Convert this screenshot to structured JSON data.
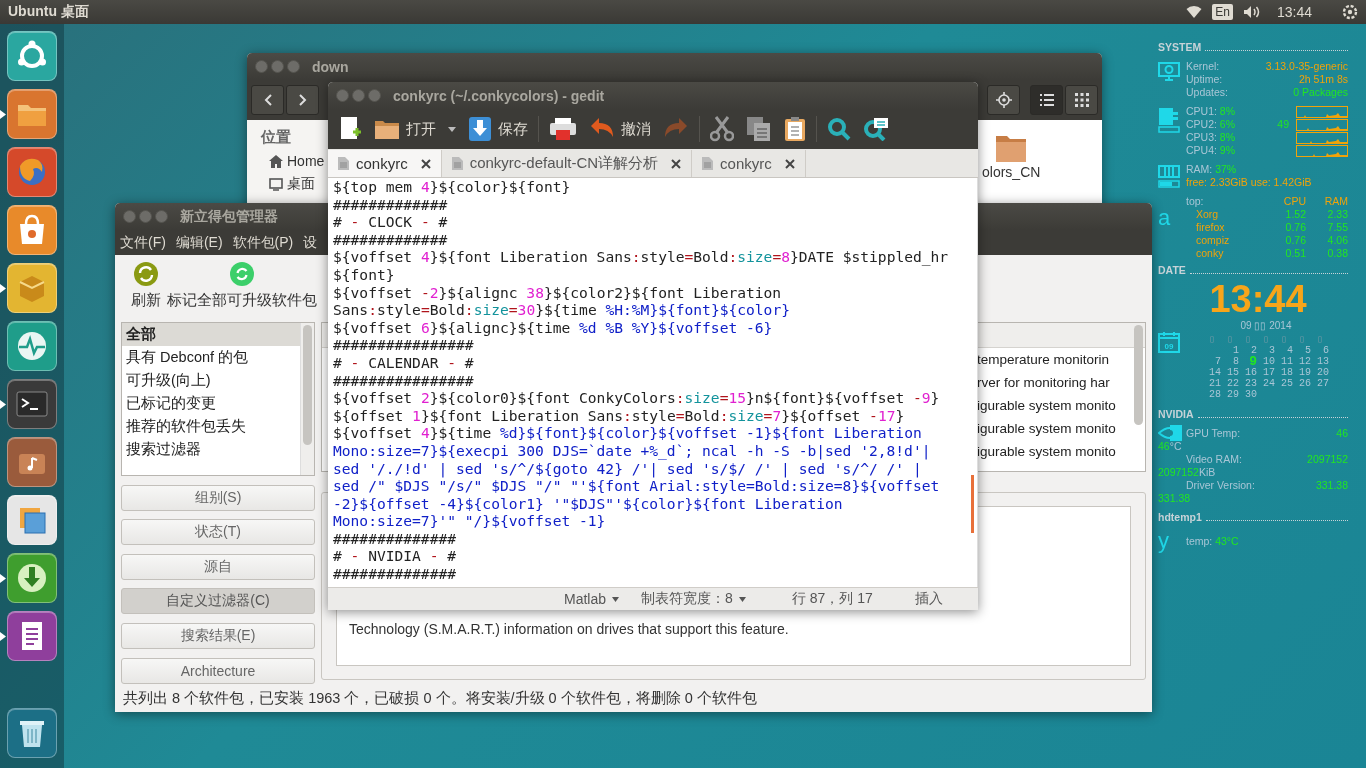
{
  "top_panel": {
    "title": "Ubuntu 桌面",
    "keyboard": "En",
    "clock": "13:44"
  },
  "launcher": {
    "items": [
      {
        "kind": "dash",
        "running": false
      },
      {
        "kind": "files",
        "running": true
      },
      {
        "kind": "browser",
        "running": false
      },
      {
        "kind": "store",
        "running": false
      },
      {
        "kind": "package",
        "running": true
      },
      {
        "kind": "monitor",
        "running": false
      },
      {
        "kind": "terminal",
        "running": true
      },
      {
        "kind": "media",
        "running": false
      },
      {
        "kind": "window",
        "running": false
      },
      {
        "kind": "download",
        "running": true
      },
      {
        "kind": "document",
        "running": true
      },
      {
        "kind": "trash",
        "running": false
      }
    ]
  },
  "file_manager": {
    "title": "down",
    "sidebar_heading": "位置",
    "places": [
      "Home",
      "桌面"
    ],
    "folder_label": "olors_CN"
  },
  "synaptic": {
    "title": "新立得包管理器",
    "menu": [
      "文件(F)",
      "编辑(E)",
      "软件包(P)",
      "设"
    ],
    "toolbar": [
      {
        "kind": "refresh",
        "label": "刷新"
      },
      {
        "kind": "mark",
        "label": "标记全部可升级软件包"
      }
    ],
    "filters": [
      {
        "label": "全部",
        "selected": true
      },
      {
        "label": "具有 Debconf 的包",
        "selected": false
      },
      {
        "label": "可升级(向上)",
        "selected": false
      },
      {
        "label": "已标记的变更",
        "selected": false
      },
      {
        "label": "推荐的软件包丢失",
        "selected": false
      },
      {
        "label": "搜索过滤器",
        "selected": false
      }
    ],
    "view_buttons": [
      {
        "label": "组别(S)",
        "selected": false
      },
      {
        "label": "状态(T)",
        "selected": false
      },
      {
        "label": "源自",
        "selected": false
      },
      {
        "label": "自定义过滤器(C)",
        "selected": true
      },
      {
        "label": "搜索结果(E)",
        "selected": false
      },
      {
        "label": "Architecture",
        "selected": false
      }
    ],
    "package_descriptions": [
      "temperature monitorin",
      "rver for monitoring har",
      "igurable system monito",
      "igurable system monito",
      "igurable system monito"
    ],
    "description": "Technology (S.M.A.R.T.) information on drives that support this feature.",
    "status_bar": "共列出 8 个软件包，已安装 1963 个，已破损 0 个。将安装/升级 0 个软件包，将删除 0 个软件包"
  },
  "gedit": {
    "title": "conkyrc (~/.conkycolors) - gedit",
    "toolbar": [
      {
        "kind": "new"
      },
      {
        "kind": "open",
        "label": "打开"
      },
      {
        "kind": "dropdown"
      },
      {
        "kind": "save",
        "label": "保存"
      },
      {
        "kind": "print"
      },
      {
        "kind": "undo",
        "label": "撤消"
      },
      {
        "kind": "redo"
      },
      {
        "kind": "cut"
      },
      {
        "kind": "copy"
      },
      {
        "kind": "paste"
      },
      {
        "kind": "search"
      },
      {
        "kind": "replace"
      }
    ],
    "tabs": [
      {
        "label": "conkyrc",
        "selected": true
      },
      {
        "label": "conkyrc-default-CN详解分析",
        "selected": false
      },
      {
        "label": "conkyrc",
        "selected": false
      }
    ],
    "code": [
      [
        {
          "kind": "plain",
          "text": "${top mem "
        },
        {
          "kind": "number",
          "text": "4"
        },
        {
          "kind": "plain",
          "text": "}${color}${font}"
        }
      ],
      [
        {
          "kind": "plain",
          "text": "#############"
        }
      ],
      [
        {
          "kind": "plain",
          "text": "# "
        },
        {
          "kind": "symbol",
          "text": "-"
        },
        {
          "kind": "plain",
          "text": " CLOCK "
        },
        {
          "kind": "symbol",
          "text": "-"
        },
        {
          "kind": "plain",
          "text": " #"
        }
      ],
      [
        {
          "kind": "plain",
          "text": "#############"
        }
      ],
      [
        {
          "kind": "plain",
          "text": "${voffset "
        },
        {
          "kind": "number",
          "text": "4"
        },
        {
          "kind": "plain",
          "text": "}${font Liberation Sans"
        },
        {
          "kind": "symbol",
          "text": ":"
        },
        {
          "kind": "plain",
          "text": "style"
        },
        {
          "kind": "symbol",
          "text": "="
        },
        {
          "kind": "plain",
          "text": "Bold"
        },
        {
          "kind": "symbol",
          "text": ":"
        },
        {
          "kind": "key",
          "text": "size"
        },
        {
          "kind": "symbol",
          "text": "="
        },
        {
          "kind": "number",
          "text": "8"
        },
        {
          "kind": "plain",
          "text": "}DATE $stippled_hr"
        }
      ],
      [
        {
          "kind": "plain",
          "text": "${font}"
        }
      ],
      [
        {
          "kind": "plain",
          "text": "${voffset "
        },
        {
          "kind": "symbol",
          "text": "-"
        },
        {
          "kind": "number",
          "text": "2"
        },
        {
          "kind": "plain",
          "text": "}${alignc "
        },
        {
          "kind": "number",
          "text": "38"
        },
        {
          "kind": "plain",
          "text": "}${color2}${font Liberation"
        }
      ],
      [
        {
          "kind": "plain",
          "text": "Sans"
        },
        {
          "kind": "symbol",
          "text": ":"
        },
        {
          "kind": "plain",
          "text": "style"
        },
        {
          "kind": "symbol",
          "text": "="
        },
        {
          "kind": "plain",
          "text": "Bold"
        },
        {
          "kind": "symbol",
          "text": ":"
        },
        {
          "kind": "key",
          "text": "size"
        },
        {
          "kind": "symbol",
          "text": "="
        },
        {
          "kind": "number",
          "text": "30"
        },
        {
          "kind": "plain",
          "text": "}${time "
        },
        {
          "kind": "string",
          "text": "%H:%M}${font}${color}"
        }
      ],
      [
        {
          "kind": "plain",
          "text": "${voffset "
        },
        {
          "kind": "number",
          "text": "6"
        },
        {
          "kind": "plain",
          "text": "}${alignc}${time "
        },
        {
          "kind": "string",
          "text": "%d %B %Y}${voffset -6}"
        }
      ],
      [
        {
          "kind": "plain",
          "text": "################"
        }
      ],
      [
        {
          "kind": "plain",
          "text": "# "
        },
        {
          "kind": "symbol",
          "text": "-"
        },
        {
          "kind": "plain",
          "text": " CALENDAR "
        },
        {
          "kind": "symbol",
          "text": "-"
        },
        {
          "kind": "plain",
          "text": " #"
        }
      ],
      [
        {
          "kind": "plain",
          "text": "################"
        }
      ],
      [
        {
          "kind": "plain",
          "text": "${voffset "
        },
        {
          "kind": "number",
          "text": "2"
        },
        {
          "kind": "plain",
          "text": "}${color0}${font ConkyColors"
        },
        {
          "kind": "symbol",
          "text": ":"
        },
        {
          "kind": "key",
          "text": "size"
        },
        {
          "kind": "symbol",
          "text": "="
        },
        {
          "kind": "number",
          "text": "15"
        },
        {
          "kind": "plain",
          "text": "}n${font}${voffset "
        },
        {
          "kind": "symbol",
          "text": "-"
        },
        {
          "kind": "number",
          "text": "9"
        },
        {
          "kind": "plain",
          "text": "}"
        }
      ],
      [
        {
          "kind": "plain",
          "text": "${offset "
        },
        {
          "kind": "number",
          "text": "1"
        },
        {
          "kind": "plain",
          "text": "}${font Liberation Sans"
        },
        {
          "kind": "symbol",
          "text": ":"
        },
        {
          "kind": "plain",
          "text": "style"
        },
        {
          "kind": "symbol",
          "text": "="
        },
        {
          "kind": "plain",
          "text": "Bold"
        },
        {
          "kind": "symbol",
          "text": ":"
        },
        {
          "kind": "key",
          "text": "size"
        },
        {
          "kind": "symbol",
          "text": "="
        },
        {
          "kind": "number",
          "text": "7"
        },
        {
          "kind": "plain",
          "text": "}${offset "
        },
        {
          "kind": "symbol",
          "text": "-"
        },
        {
          "kind": "number",
          "text": "17"
        },
        {
          "kind": "plain",
          "text": "}"
        }
      ],
      [
        {
          "kind": "plain",
          "text": "${voffset "
        },
        {
          "kind": "number",
          "text": "4"
        },
        {
          "kind": "plain",
          "text": "}${time "
        },
        {
          "kind": "string",
          "text": "%d}${font}${color}${voffset -1}${font Liberation"
        }
      ],
      [
        {
          "kind": "string",
          "text": "Mono:size=7}${execpi 300 DJS=`date +%_d`; ncal -h -S -b|sed '2,8!d'|"
        }
      ],
      [
        {
          "kind": "string",
          "text": "sed '/./!d' | sed 's/^/${goto 42} /'| sed 's/$/ /' | sed 's/^/ /' |"
        }
      ],
      [
        {
          "kind": "string",
          "text": "sed /\" $DJS \"/s/\" $DJS \"/\" \"'${font Arial:style=Bold:size=8}${voffset"
        }
      ],
      [
        {
          "kind": "string",
          "text": "-2}${offset -4}${color1} '\"$DJS\"'${color}${font Liberation"
        }
      ],
      [
        {
          "kind": "string",
          "text": "Mono:size=7}'\" \"/}${voffset -1}"
        }
      ],
      [
        {
          "kind": "plain",
          "text": "##############"
        }
      ],
      [
        {
          "kind": "plain",
          "text": "# "
        },
        {
          "kind": "symbol",
          "text": "-"
        },
        {
          "kind": "plain",
          "text": " NVIDIA "
        },
        {
          "kind": "symbol",
          "text": "-"
        },
        {
          "kind": "plain",
          "text": " #"
        }
      ],
      [
        {
          "kind": "plain",
          "text": "##############"
        }
      ]
    ],
    "status": {
      "language": "Matlab",
      "tab_width": "制表符宽度：8",
      "position": "行 87，列 17",
      "mode": "插入"
    }
  },
  "conky": {
    "system": {
      "heading": "SYSTEM",
      "info": [
        {
          "label": "Kernel:",
          "value": "3.13.0-35-generic",
          "color": "#f0a30a"
        },
        {
          "label": "Uptime:",
          "value": "2h 51m 8s",
          "color": "#f0a30a"
        },
        {
          "label": "Updates:",
          "value": "0 Packages",
          "color": "#22e622"
        }
      ],
      "cpus": [
        {
          "label": "CPU1:",
          "value": "8%"
        },
        {
          "label": "CPU2:",
          "value": "6%",
          "extra": "49"
        },
        {
          "label": "CPU3:",
          "value": "8%"
        },
        {
          "label": "CPU4:",
          "value": "9%"
        }
      ],
      "ram": {
        "label": "RAM:",
        "value": "37%",
        "free_label": "free:",
        "free": "2.33GiB",
        "use_label": "use:",
        "use": "1.42GiB"
      },
      "top": {
        "glyph": "a",
        "label": "top:",
        "cpu_heading": "CPU",
        "ram_heading": "RAM",
        "processes": [
          {
            "name": "Xorg",
            "cpu": "1.52",
            "ram": "2.33"
          },
          {
            "name": "firefox",
            "cpu": "0.76",
            "ram": "7.55"
          },
          {
            "name": "compiz",
            "cpu": "0.76",
            "ram": "4.06"
          },
          {
            "name": "conky",
            "cpu": "0.51",
            "ram": "0.38"
          }
        ]
      }
    },
    "date": {
      "heading": "DATE",
      "time": "13:44",
      "icon_day": "09",
      "month_line": "09 ▯▯ 2014",
      "weekdays": [
        "▯",
        "▯",
        "▯",
        "▯",
        "▯",
        "▯",
        "▯"
      ],
      "weeks": [
        [
          {
            "day": "1",
            "selected": false
          },
          {
            "day": "2",
            "selected": false
          },
          {
            "day": "3",
            "selected": false
          },
          {
            "day": "4",
            "selected": false
          },
          {
            "day": "5",
            "selected": false
          },
          {
            "day": "6",
            "selected": false
          }
        ],
        [
          {
            "day": "7",
            "selected": false
          },
          {
            "day": "8",
            "selected": false
          },
          {
            "day": "9",
            "selected": true
          },
          {
            "day": "10",
            "selected": false
          },
          {
            "day": "11",
            "selected": false
          },
          {
            "day": "12",
            "selected": false
          },
          {
            "day": "13",
            "selected": false
          }
        ],
        [
          {
            "day": "14",
            "selected": false
          },
          {
            "day": "15",
            "selected": false
          },
          {
            "day": "16",
            "selected": false
          },
          {
            "day": "17",
            "selected": false
          },
          {
            "day": "18",
            "selected": false
          },
          {
            "day": "19",
            "selected": false
          },
          {
            "day": "20",
            "selected": false
          }
        ],
        [
          {
            "day": "21",
            "selected": false
          },
          {
            "day": "22",
            "selected": false
          },
          {
            "day": "23",
            "selected": false
          },
          {
            "day": "24",
            "selected": false
          },
          {
            "day": "25",
            "selected": false
          },
          {
            "day": "26",
            "selected": false
          },
          {
            "day": "27",
            "selected": false
          }
        ],
        [
          {
            "day": "28",
            "selected": false
          },
          {
            "day": "29",
            "selected": false
          },
          {
            "day": "30",
            "selected": false
          }
        ]
      ]
    },
    "nvidia": {
      "heading": "NVIDIA",
      "rows": [
        {
          "label": "GPU Temp:",
          "value": "46",
          "repeat": "46",
          "unit": "°C"
        },
        {
          "label": "Video RAM:",
          "value": "2097152",
          "repeat": "2097152",
          "unit": "KiB"
        },
        {
          "label": "Driver Version:",
          "value": "331.38",
          "repeat": "331.38"
        }
      ]
    },
    "hdtemp": {
      "heading": "hdtemp1",
      "glyph": "y",
      "label": "temp:",
      "value": "43°C"
    }
  }
}
